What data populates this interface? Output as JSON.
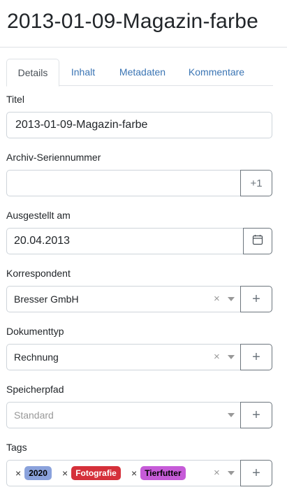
{
  "page": {
    "title": "2013-01-09-Magazin-farbe"
  },
  "tabs": [
    {
      "label": "Details",
      "active": true
    },
    {
      "label": "Inhalt",
      "active": false
    },
    {
      "label": "Metadaten",
      "active": false
    },
    {
      "label": "Kommentare",
      "active": false
    }
  ],
  "fields": {
    "title": {
      "label": "Titel",
      "value": "2013-01-09-Magazin-farbe"
    },
    "asn": {
      "label": "Archiv-Seriennummer",
      "value": "",
      "addon_label": "+1"
    },
    "created": {
      "label": "Ausgestellt am",
      "value": "20.04.2013",
      "addon_icon": "calendar-icon"
    },
    "correspondent": {
      "label": "Korrespondent",
      "value": "Bresser GmbH",
      "clear": "×",
      "addon_label": "+"
    },
    "document_type": {
      "label": "Dokumenttyp",
      "value": "Rechnung",
      "clear": "×",
      "addon_label": "+"
    },
    "storage_path": {
      "label": "Speicherpfad",
      "placeholder": "Standard",
      "addon_label": "+"
    },
    "tags": {
      "label": "Tags",
      "clear": "×",
      "addon_label": "+",
      "items": [
        {
          "remove": "×",
          "name": "2020",
          "color": "#8aa2dc",
          "text_color": "#000000"
        },
        {
          "remove": "×",
          "name": "Fotografie",
          "color": "#d5303a",
          "text_color": "#ffffff"
        },
        {
          "remove": "×",
          "name": "Tierfutter",
          "color": "#c65bd8",
          "text_color": "#000000"
        }
      ]
    }
  }
}
